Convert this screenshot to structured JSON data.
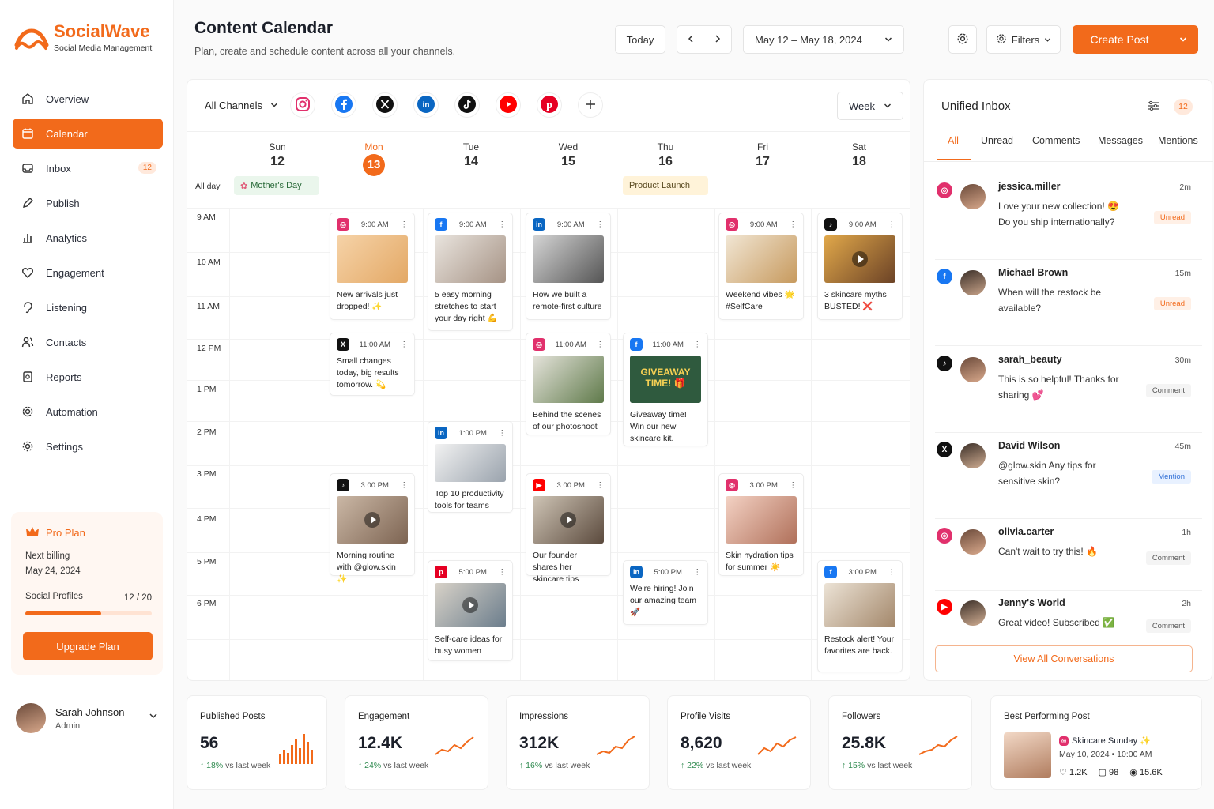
{
  "brand": {
    "name": "SocialWave",
    "tagline": "Social Media Management",
    "accent": "#f26a1b"
  },
  "nav": [
    {
      "label": "Overview",
      "icon": "home-icon"
    },
    {
      "label": "Calendar",
      "icon": "calendar-icon",
      "active": true
    },
    {
      "label": "Inbox",
      "icon": "inbox-icon",
      "badge": "12"
    },
    {
      "label": "Publish",
      "icon": "pencil-icon"
    },
    {
      "label": "Analytics",
      "icon": "bar-chart-icon"
    },
    {
      "label": "Engagement",
      "icon": "heart-icon"
    },
    {
      "label": "Listening",
      "icon": "ear-icon"
    },
    {
      "label": "Contacts",
      "icon": "users-icon"
    },
    {
      "label": "Reports",
      "icon": "report-icon"
    },
    {
      "label": "Automation",
      "icon": "gear-icon"
    },
    {
      "label": "Settings",
      "icon": "settings-icon"
    }
  ],
  "plan": {
    "title": "Pro Plan",
    "billing_label": "Next billing",
    "billing_date": "May 24, 2024",
    "profiles_label": "Social Profiles",
    "profiles_value": "12 / 20",
    "profiles_fraction": 0.6,
    "upgrade": "Upgrade Plan"
  },
  "user": {
    "name": "Sarah Johnson",
    "role": "Admin"
  },
  "header": {
    "title": "Content Calendar",
    "subtitle": "Plan, create and schedule content across all your channels.",
    "today": "Today",
    "range": "May 12 – May 18, 2024",
    "filters": "Filters",
    "create": "Create Post"
  },
  "calendar": {
    "channels_label": "All Channels",
    "view": "Week",
    "allday_label": "All day",
    "days": [
      {
        "name": "Sun",
        "date": "12"
      },
      {
        "name": "Mon",
        "date": "13",
        "today": true
      },
      {
        "name": "Tue",
        "date": "14"
      },
      {
        "name": "Wed",
        "date": "15"
      },
      {
        "name": "Thu",
        "date": "16"
      },
      {
        "name": "Fri",
        "date": "17"
      },
      {
        "name": "Sat",
        "date": "18"
      }
    ],
    "times": [
      "9 AM",
      "10 AM",
      "11 AM",
      "12 PM",
      "1 PM",
      "2 PM",
      "3 PM",
      "4 PM",
      "5 PM",
      "6 PM"
    ],
    "events": {
      "mothers_day": "Mother's Day",
      "product_launch": "Product Launch"
    },
    "posts": {
      "p1": {
        "time": "9:00 AM",
        "text": "New arrivals just dropped! ✨"
      },
      "p2": {
        "time": "11:00 AM",
        "text": "Small changes today, big results tomorrow. 💫"
      },
      "p3": {
        "time": "3:00 PM",
        "text": "Morning routine with @glow.skin ✨"
      },
      "p4": {
        "time": "9:00 AM",
        "text": "5 easy morning stretches to start your day right 💪"
      },
      "p5": {
        "time": "1:00 PM",
        "text": "Top 10 productivity tools for teams"
      },
      "p6": {
        "time": "5:00 PM",
        "text": "Self-care ideas for busy women"
      },
      "p7": {
        "time": "9:00 AM",
        "text": "How we built a remote-first culture"
      },
      "p8": {
        "time": "11:00 AM",
        "text": "Behind the scenes of our photoshoot"
      },
      "p9": {
        "time": "3:00 PM",
        "text": "Our founder shares her skincare tips"
      },
      "p10": {
        "time": "11:00 AM",
        "text": "Giveaway time! Win our new skincare kit.",
        "thumb_text": "GIVEAWAY TIME! 🎁"
      },
      "p11": {
        "time": "5:00 PM",
        "text": "We're hiring! Join our amazing team 🚀"
      },
      "p12": {
        "time": "9:00 AM",
        "text": "Weekend vibes 🌟 #SelfCare"
      },
      "p13": {
        "time": "3:00 PM",
        "text": "Skin hydration tips for summer ☀️"
      },
      "p14": {
        "time": "9:00 AM",
        "text": "3 skincare myths BUSTED! ❌"
      },
      "p15": {
        "time": "3:00 PM",
        "text": "Restock alert! Your favorites are back."
      }
    }
  },
  "inbox": {
    "title": "Unified Inbox",
    "count": "12",
    "tabs": [
      "All",
      "Unread",
      "Comments",
      "Messages",
      "Mentions"
    ],
    "messages": [
      {
        "name": "jessica.miller",
        "text": "Love your new collection! 😍 Do you ship internationally?",
        "time": "2m",
        "tag": "Unread",
        "platform": "instagram"
      },
      {
        "name": "Michael Brown",
        "text": "When will the restock be available?",
        "time": "15m",
        "tag": "Unread",
        "platform": "facebook"
      },
      {
        "name": "sarah_beauty",
        "text": "This is so helpful! Thanks for sharing 💕",
        "time": "30m",
        "tag": "Comment",
        "platform": "tiktok"
      },
      {
        "name": "David Wilson",
        "text": "@glow.skin Any tips for sensitive skin?",
        "time": "45m",
        "tag": "Mention",
        "platform": "x"
      },
      {
        "name": "olivia.carter",
        "text": "Can't wait to try this! 🔥",
        "time": "1h",
        "tag": "Comment",
        "platform": "instagram"
      },
      {
        "name": "Jenny's World",
        "text": "Great video! Subscribed ✅",
        "time": "2h",
        "tag": "Comment",
        "platform": "youtube"
      }
    ],
    "view_all": "View All Conversations"
  },
  "stats": [
    {
      "title": "Published Posts",
      "value": "56",
      "delta": "18%",
      "delta_label": "vs last week"
    },
    {
      "title": "Engagement",
      "value": "12.4K",
      "delta": "24%",
      "delta_label": "vs last week"
    },
    {
      "title": "Impressions",
      "value": "312K",
      "delta": "16%",
      "delta_label": "vs last week"
    },
    {
      "title": "Profile Visits",
      "value": "8,620",
      "delta": "22%",
      "delta_label": "vs last week"
    },
    {
      "title": "Followers",
      "value": "25.8K",
      "delta": "15%",
      "delta_label": "vs last week"
    }
  ],
  "best_post": {
    "title": "Best Performing Post",
    "name": "Skincare Sunday ✨",
    "date": "May 10, 2024",
    "time": "10:00 AM",
    "likes": "1.2K",
    "comments": "98",
    "views": "15.6K"
  }
}
